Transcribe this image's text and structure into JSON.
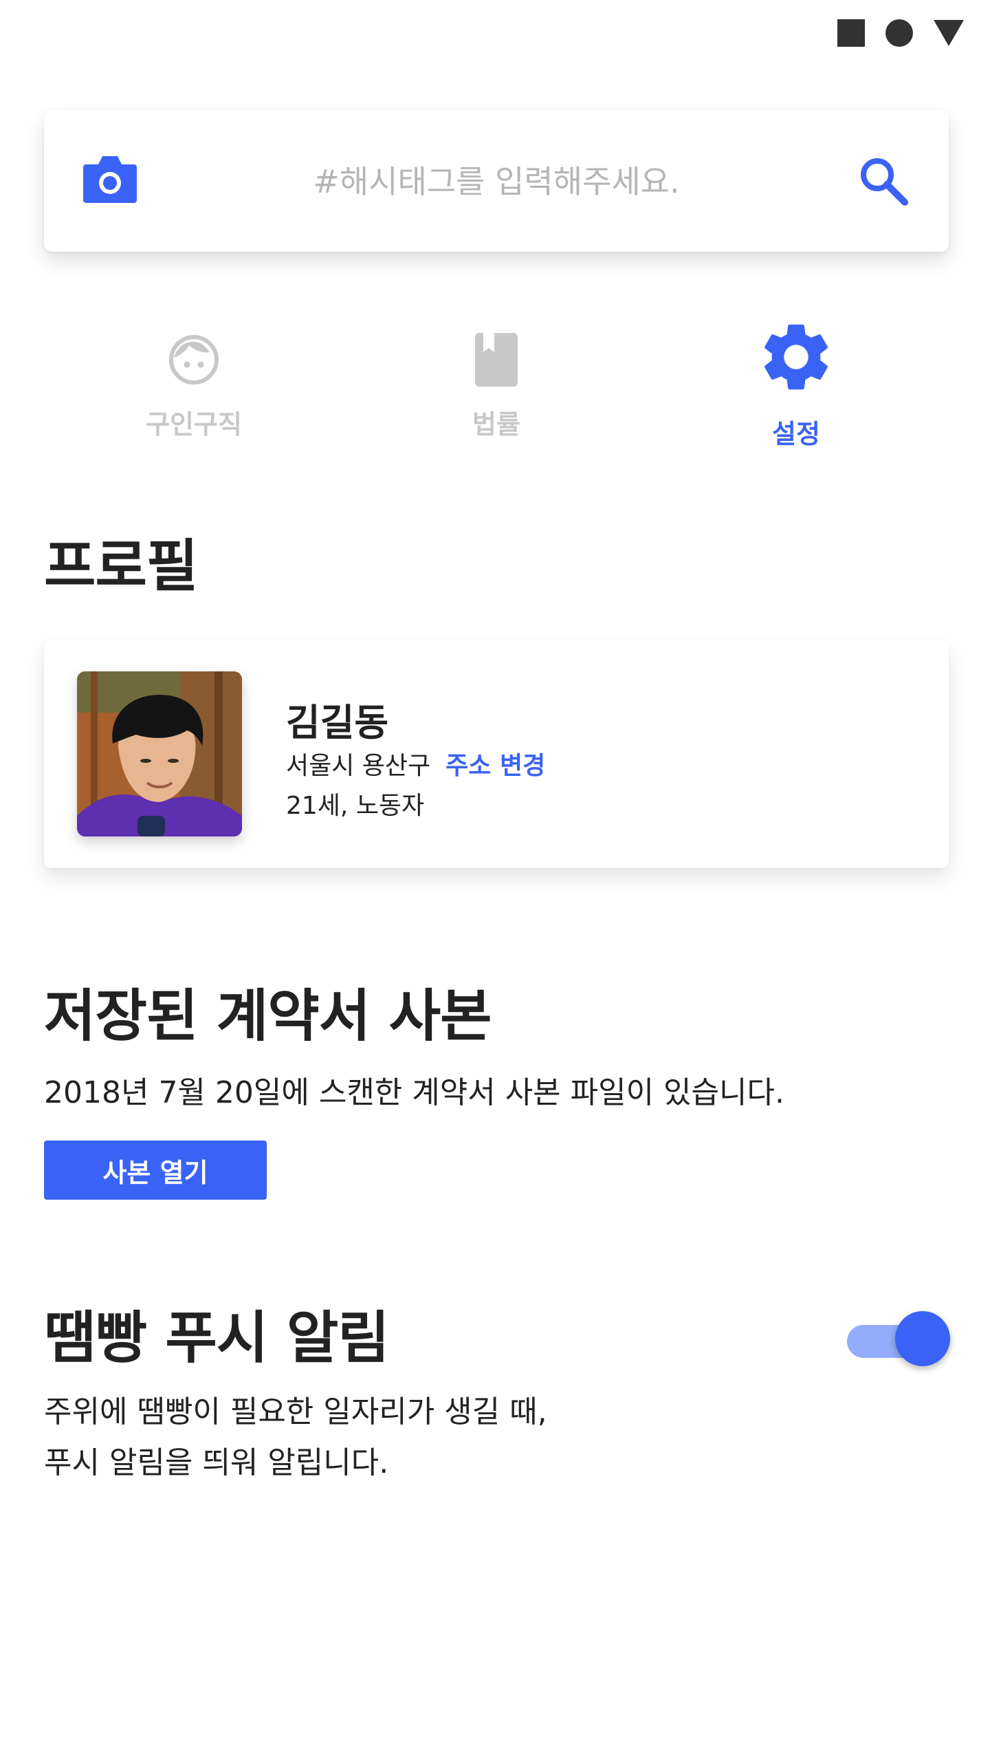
{
  "search": {
    "placeholder": "#해시태그를 입력해주세요."
  },
  "nav": {
    "tabs": [
      {
        "label": "구인구직",
        "icon": "face-icon",
        "active": false
      },
      {
        "label": "법률",
        "icon": "book-icon",
        "active": false
      },
      {
        "label": "설정",
        "icon": "gear-icon",
        "active": true
      }
    ]
  },
  "profile": {
    "section_title": "프로필",
    "name": "김길동",
    "address": "서울시 용산구",
    "change_address_label": "주소 변경",
    "meta": "21세, 노동자"
  },
  "contract": {
    "section_title": "저장된 계약서 사본",
    "description": "2018년 7월 20일에 스캔한 계약서 사본 파일이 있습니다.",
    "open_button_label": "사본 열기"
  },
  "push": {
    "section_title": "땜빵 푸시 알림",
    "description_line1": "주위에 땜빵이 필요한 일자리가 생길 때,",
    "description_line2": "푸시 알림을 띄워 알립니다.",
    "enabled": true
  },
  "colors": {
    "accent": "#3a63f5",
    "inactive": "#c8c8c8",
    "text": "#222222",
    "toggle_track": "#93acfb"
  }
}
